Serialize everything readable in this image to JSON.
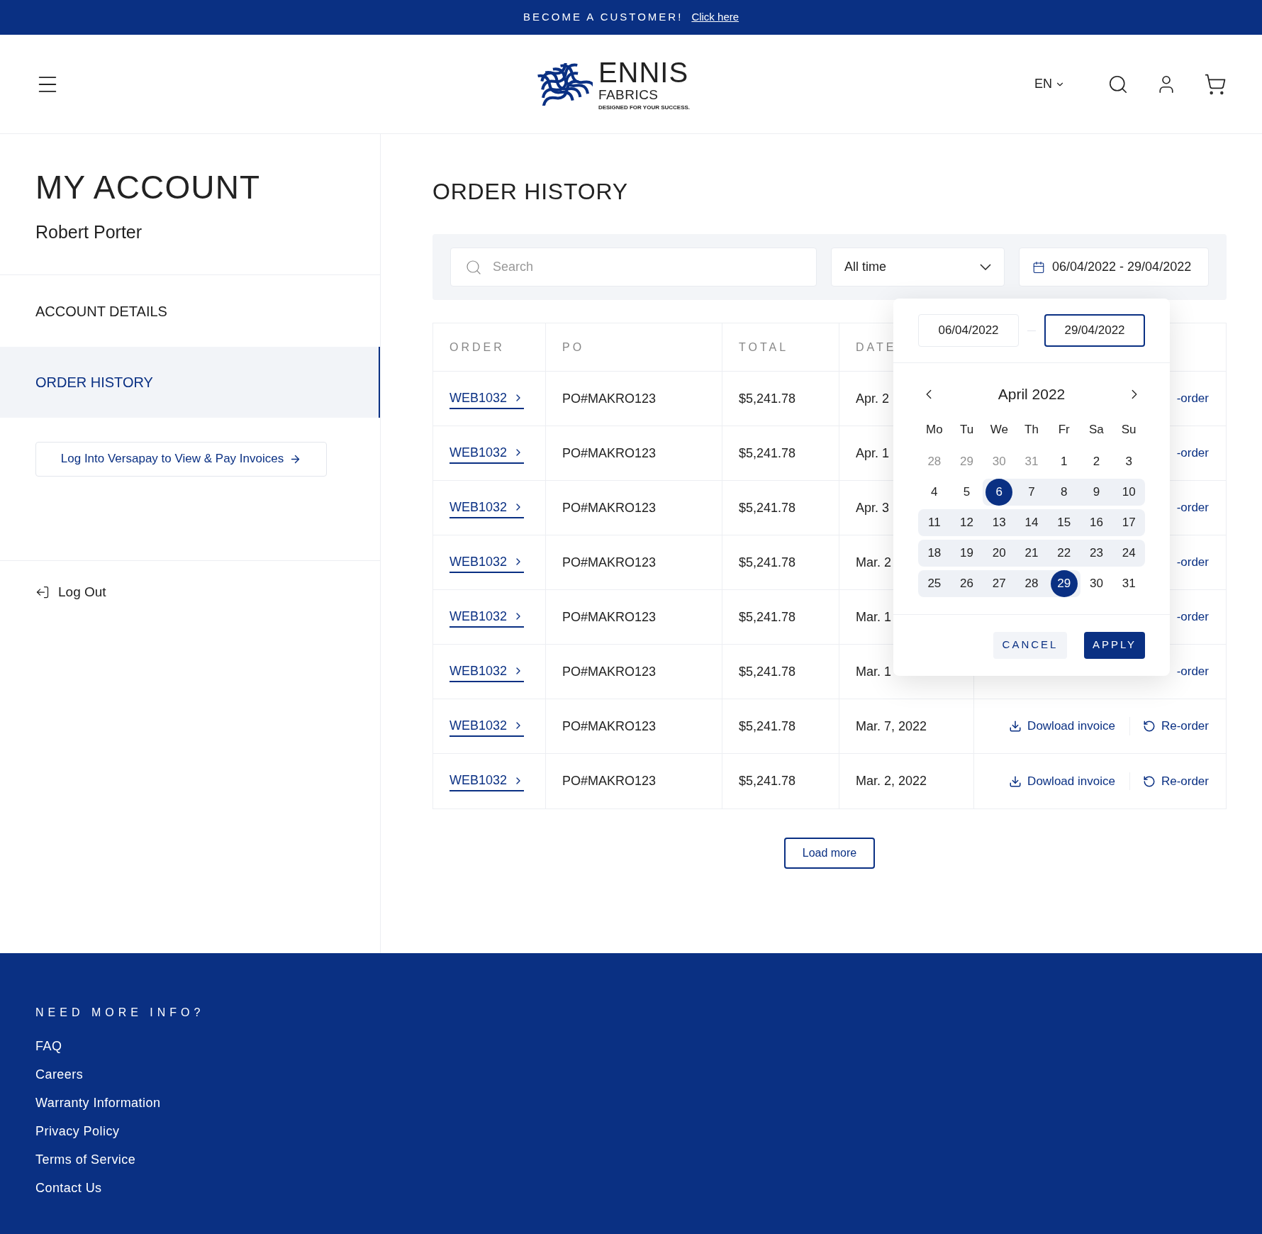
{
  "banner": {
    "text": "BECOME A CUSTOMER!",
    "link": "Click here"
  },
  "header": {
    "logo": {
      "name": "ENNIS",
      "sub": "FABRICS",
      "tagline": "DESIGNED FOR YOUR SUCCESS."
    },
    "language": "EN"
  },
  "sidebar": {
    "title": "MY ACCOUNT",
    "user": "Robert Porter",
    "items": [
      {
        "label": "ACCOUNT DETAILS",
        "selected": false
      },
      {
        "label": "ORDER HISTORY",
        "selected": true
      }
    ],
    "versapay_button": "Log Into Versapay to View & Pay Invoices",
    "logout": "Log Out"
  },
  "main": {
    "title": "ORDER HISTORY",
    "filters": {
      "search": {
        "placeholder": "Search"
      },
      "period": "All time",
      "date_range": "06/04/2022 - 29/04/2022"
    },
    "table": {
      "columns": [
        "ORDER",
        "PO",
        "TOTAL",
        "DATE"
      ],
      "rows": [
        {
          "order": "WEB1032",
          "po": "PO#MAKRO123",
          "total": "$5,241.78",
          "date": "Apr. 2",
          "actions": {
            "kind": "partial",
            "reorder": "-order"
          }
        },
        {
          "order": "WEB1032",
          "po": "PO#MAKRO123",
          "total": "$5,241.78",
          "date": "Apr. 1",
          "actions": {
            "kind": "partial",
            "reorder": "-order"
          }
        },
        {
          "order": "WEB1032",
          "po": "PO#MAKRO123",
          "total": "$5,241.78",
          "date": "Apr. 3",
          "actions": {
            "kind": "partial",
            "reorder": "-order"
          }
        },
        {
          "order": "WEB1032",
          "po": "PO#MAKRO123",
          "total": "$5,241.78",
          "date": "Mar. 2",
          "actions": {
            "kind": "partial",
            "reorder": "-order"
          }
        },
        {
          "order": "WEB1032",
          "po": "PO#MAKRO123",
          "total": "$5,241.78",
          "date": "Mar. 1",
          "actions": {
            "kind": "partial",
            "reorder": "-order"
          }
        },
        {
          "order": "WEB1032",
          "po": "PO#MAKRO123",
          "total": "$5,241.78",
          "date": "Mar. 1",
          "actions": {
            "kind": "partial",
            "reorder": "-order"
          }
        },
        {
          "order": "WEB1032",
          "po": "PO#MAKRO123",
          "total": "$5,241.78",
          "date": "Mar. 7, 2022",
          "actions": {
            "kind": "full",
            "download": "Dowload invoice",
            "reorder": "Re-order"
          }
        },
        {
          "order": "WEB1032",
          "po": "PO#MAKRO123",
          "total": "$5,241.78",
          "date": "Mar. 2, 2022",
          "actions": {
            "kind": "full",
            "download": "Dowload invoice",
            "reorder": "Re-order"
          }
        }
      ]
    },
    "load_more": "Load more",
    "date_picker": {
      "inputs": [
        {
          "value": "06/04/2022",
          "focused": false
        },
        {
          "value": "29/04/2022",
          "focused": true
        }
      ],
      "month": "April 2022",
      "weekdays": [
        "Mo",
        "Tu",
        "We",
        "Th",
        "Fr",
        "Sa",
        "Su"
      ],
      "weeks": [
        [
          {
            "label": "28",
            "outside": true,
            "selected": false,
            "in_range": false
          },
          {
            "label": "29",
            "outside": true,
            "selected": false,
            "in_range": false
          },
          {
            "label": "30",
            "outside": true,
            "selected": false,
            "in_range": false
          },
          {
            "label": "31",
            "outside": true,
            "selected": false,
            "in_range": false
          },
          {
            "label": "1",
            "outside": false,
            "selected": false,
            "in_range": false
          },
          {
            "label": "2",
            "outside": false,
            "selected": false,
            "in_range": false
          },
          {
            "label": "3",
            "outside": false,
            "selected": false,
            "in_range": false
          }
        ],
        [
          {
            "label": "4",
            "outside": false,
            "selected": false,
            "in_range": false
          },
          {
            "label": "5",
            "outside": false,
            "selected": false,
            "in_range": false
          },
          {
            "label": "6",
            "outside": false,
            "selected": true,
            "in_range": true
          },
          {
            "label": "7",
            "outside": false,
            "selected": false,
            "in_range": true
          },
          {
            "label": "8",
            "outside": false,
            "selected": false,
            "in_range": true
          },
          {
            "label": "9",
            "outside": false,
            "selected": false,
            "in_range": true
          },
          {
            "label": "10",
            "outside": false,
            "selected": false,
            "in_range": true
          }
        ],
        [
          {
            "label": "11",
            "outside": false,
            "selected": false,
            "in_range": true
          },
          {
            "label": "12",
            "outside": false,
            "selected": false,
            "in_range": true
          },
          {
            "label": "13",
            "outside": false,
            "selected": false,
            "in_range": true
          },
          {
            "label": "14",
            "outside": false,
            "selected": false,
            "in_range": true
          },
          {
            "label": "15",
            "outside": false,
            "selected": false,
            "in_range": true
          },
          {
            "label": "16",
            "outside": false,
            "selected": false,
            "in_range": true
          },
          {
            "label": "17",
            "outside": false,
            "selected": false,
            "in_range": true
          }
        ],
        [
          {
            "label": "18",
            "outside": false,
            "selected": false,
            "in_range": true
          },
          {
            "label": "19",
            "outside": false,
            "selected": false,
            "in_range": true
          },
          {
            "label": "20",
            "outside": false,
            "selected": false,
            "in_range": true
          },
          {
            "label": "21",
            "outside": false,
            "selected": false,
            "in_range": true
          },
          {
            "label": "22",
            "outside": false,
            "selected": false,
            "in_range": true
          },
          {
            "label": "23",
            "outside": false,
            "selected": false,
            "in_range": true
          },
          {
            "label": "24",
            "outside": false,
            "selected": false,
            "in_range": true
          }
        ],
        [
          {
            "label": "25",
            "outside": false,
            "selected": false,
            "in_range": true
          },
          {
            "label": "26",
            "outside": false,
            "selected": false,
            "in_range": true
          },
          {
            "label": "27",
            "outside": false,
            "selected": false,
            "in_range": true
          },
          {
            "label": "28",
            "outside": false,
            "selected": false,
            "in_range": true
          },
          {
            "label": "29",
            "outside": false,
            "selected": true,
            "in_range": true
          },
          {
            "label": "30",
            "outside": false,
            "selected": false,
            "in_range": false
          },
          {
            "label": "31",
            "outside": false,
            "selected": false,
            "in_range": false
          }
        ]
      ],
      "cancel": "CANCEL",
      "apply": "APPLY"
    }
  },
  "footer": {
    "heading": "NEED MORE INFO?",
    "links": [
      "FAQ",
      "Careers",
      "Warranty Information",
      "Privacy Policy",
      "Terms of Service",
      "Contact Us"
    ]
  }
}
